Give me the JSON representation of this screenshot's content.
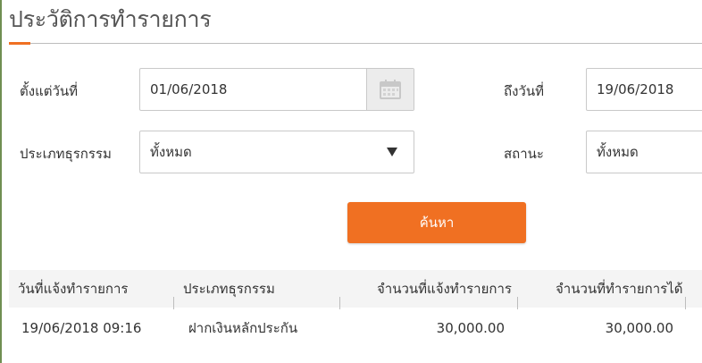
{
  "page": {
    "title": "ประวัติการทำรายการ"
  },
  "filters": {
    "from_label": "ตั้งแต่วันที่",
    "from_value": "01/06/2018",
    "to_label": "ถึงวันที่",
    "to_value": "19/06/2018",
    "type_label": "ประเภทธุรกรรม",
    "type_value": "ทั้งหมด",
    "status_label": "สถานะ",
    "status_value": "ทั้งหมด"
  },
  "search_button": {
    "label": "ค้นหา"
  },
  "table": {
    "headers": [
      "วันที่แจ้งทำรายการ",
      "ประเภทธุรกรรม",
      "จำนวนที่แจ้งทำรายการ",
      "จำนวนที่ทำรายการได้"
    ],
    "rows": [
      [
        "19/06/2018 09:16",
        "ฝากเงินหลักประกัน",
        "30,000.00",
        "30,000.00"
      ]
    ]
  },
  "colors": {
    "accent": "#f07022",
    "header_bg": "#f4f4f4"
  }
}
